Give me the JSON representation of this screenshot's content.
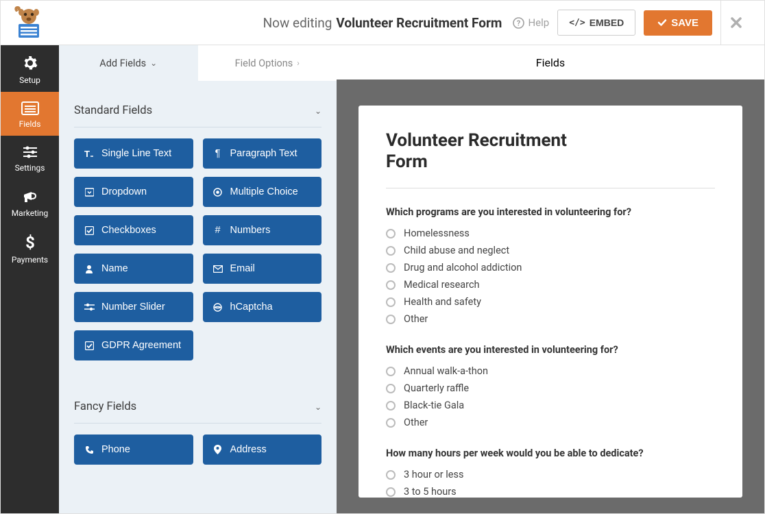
{
  "topbar": {
    "now_editing": "Now editing",
    "form_name": "Volunteer Recruitment Form",
    "help": "Help",
    "embed": "EMBED",
    "save": "SAVE"
  },
  "leftnav": [
    {
      "key": "setup",
      "label": "Setup"
    },
    {
      "key": "fields",
      "label": "Fields",
      "active": true
    },
    {
      "key": "settings",
      "label": "Settings"
    },
    {
      "key": "marketing",
      "label": "Marketing"
    },
    {
      "key": "payments",
      "label": "Payments"
    }
  ],
  "panels_title": "Fields",
  "tabs": {
    "add_fields": "Add Fields",
    "field_options": "Field Options"
  },
  "sections": {
    "standard": {
      "title": "Standard Fields",
      "fields": [
        {
          "icon": "single-line-text-icon",
          "label": "Single Line Text"
        },
        {
          "icon": "paragraph-text-icon",
          "label": "Paragraph Text"
        },
        {
          "icon": "dropdown-icon",
          "label": "Dropdown"
        },
        {
          "icon": "multiple-choice-icon",
          "label": "Multiple Choice"
        },
        {
          "icon": "checkboxes-icon",
          "label": "Checkboxes"
        },
        {
          "icon": "numbers-icon",
          "label": "Numbers"
        },
        {
          "icon": "name-icon",
          "label": "Name"
        },
        {
          "icon": "email-icon",
          "label": "Email"
        },
        {
          "icon": "number-slider-icon",
          "label": "Number Slider"
        },
        {
          "icon": "hcaptcha-icon",
          "label": "hCaptcha"
        },
        {
          "icon": "gdpr-icon",
          "label": "GDPR Agreement"
        }
      ]
    },
    "fancy": {
      "title": "Fancy Fields",
      "fields": [
        {
          "icon": "phone-icon",
          "label": "Phone"
        },
        {
          "icon": "address-icon",
          "label": "Address"
        }
      ]
    }
  },
  "preview": {
    "form_title": "Volunteer Recruitment Form",
    "questions": [
      {
        "label": "Which programs are you interested in volunteering for?",
        "options": [
          "Homelessness",
          "Child abuse and neglect",
          "Drug and alcohol addiction",
          "Medical research",
          "Health and safety",
          "Other"
        ]
      },
      {
        "label": "Which events are you interested in volunteering for?",
        "options": [
          "Annual walk-a-thon",
          "Quarterly raffle",
          "Black-tie Gala",
          "Other"
        ]
      },
      {
        "label": "How many hours per week would you be able to dedicate?",
        "options": [
          "3 hour or less",
          "3 to 5 hours"
        ]
      }
    ]
  }
}
